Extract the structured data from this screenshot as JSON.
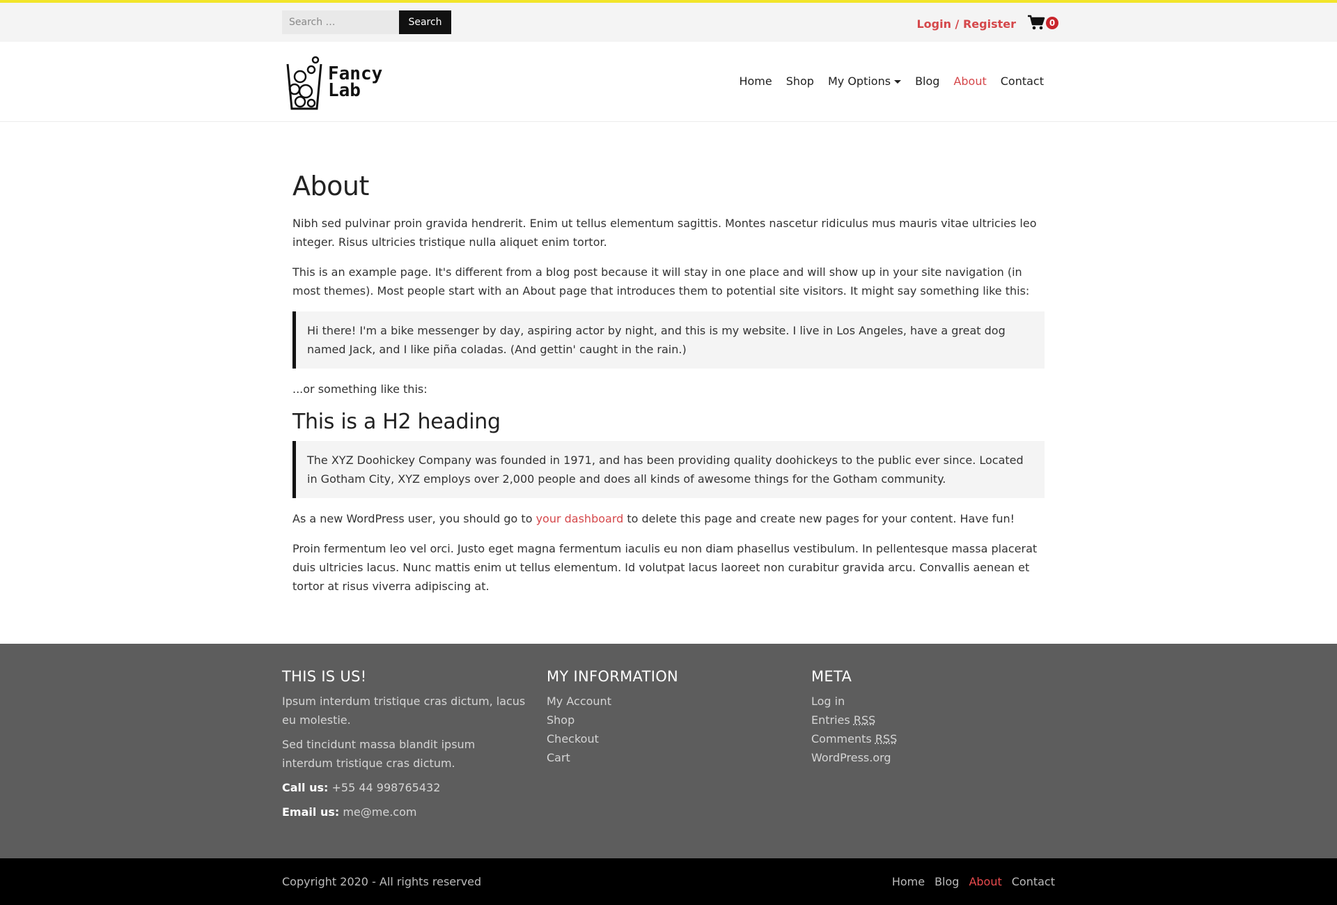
{
  "topbar": {
    "search_placeholder": "Search …",
    "search_button": "Search",
    "login_label": "Login / Register",
    "cart_count": "0"
  },
  "logo": {
    "line1": "Fancy",
    "line2": "Lab"
  },
  "nav": {
    "items": [
      "Home",
      "Shop",
      "My Options",
      "Blog",
      "About",
      "Contact"
    ],
    "active": "About"
  },
  "page": {
    "title": "About",
    "p1": "Nibh sed pulvinar proin gravida hendrerit. Enim ut tellus elementum sagittis. Montes nascetur ridiculus mus mauris vitae ultricies leo integer. Risus ultricies tristique nulla aliquet enim tortor.",
    "p2": "This is an example page. It's different from a blog post because it will stay in one place and will show up in your site navigation (in most themes). Most people start with an About page that introduces them to potential site visitors. It might say something like this:",
    "quote1": "Hi there! I'm a bike messenger by day, aspiring actor by night, and this is my website. I live in Los Angeles, have a great dog named Jack, and I like piña coladas. (And gettin' caught in the rain.)",
    "p3": "...or something like this:",
    "h2": "This is a H2 heading",
    "quote2": "The XYZ Doohickey Company was founded in 1971, and has been providing quality doohickeys to the public ever since. Located in Gotham City, XYZ employs over 2,000 people and does all kinds of awesome things for the Gotham community.",
    "p4_before": "As a new WordPress user, you should go to ",
    "p4_link": "your dashboard",
    "p4_after": " to delete this page and create new pages for your content. Have fun!",
    "p5": "Proin fermentum leo vel orci. Justo eget magna fermentum iaculis eu non diam phasellus vestibulum. In pellentesque massa placerat duis ultricies lacus. Nunc mattis enim ut tellus elementum. Id volutpat lacus laoreet non curabitur gravida arcu. Convallis aenean et tortor at risus viverra adipiscing at."
  },
  "footer": {
    "col1": {
      "title": "THIS IS US!",
      "p1": "Ipsum interdum tristique cras dictum, lacus eu molestie.",
      "p2": "Sed tincidunt massa blandit ipsum interdum tristique cras dictum.",
      "call_label": "Call us:",
      "call_value": "+55 44 998765432",
      "email_label": "Email us:",
      "email_value": "me@me.com"
    },
    "col2": {
      "title": "MY INFORMATION",
      "links": [
        "My Account",
        "Shop",
        "Checkout",
        "Cart"
      ]
    },
    "col3": {
      "title": "META",
      "login": "Log in",
      "entries": "Entries",
      "comments": "Comments",
      "rss": "RSS",
      "wordpress": "WordPress.org"
    }
  },
  "bottom": {
    "copyright": "Copyright 2020 - All rights reserved",
    "links": [
      "Home",
      "Blog",
      "About",
      "Contact"
    ],
    "active": "About"
  },
  "colors": {
    "accent": "#d5484b",
    "top_border": "#f2e52a",
    "footer_bg": "#5d5d5d",
    "bottom_bg": "#000000"
  }
}
